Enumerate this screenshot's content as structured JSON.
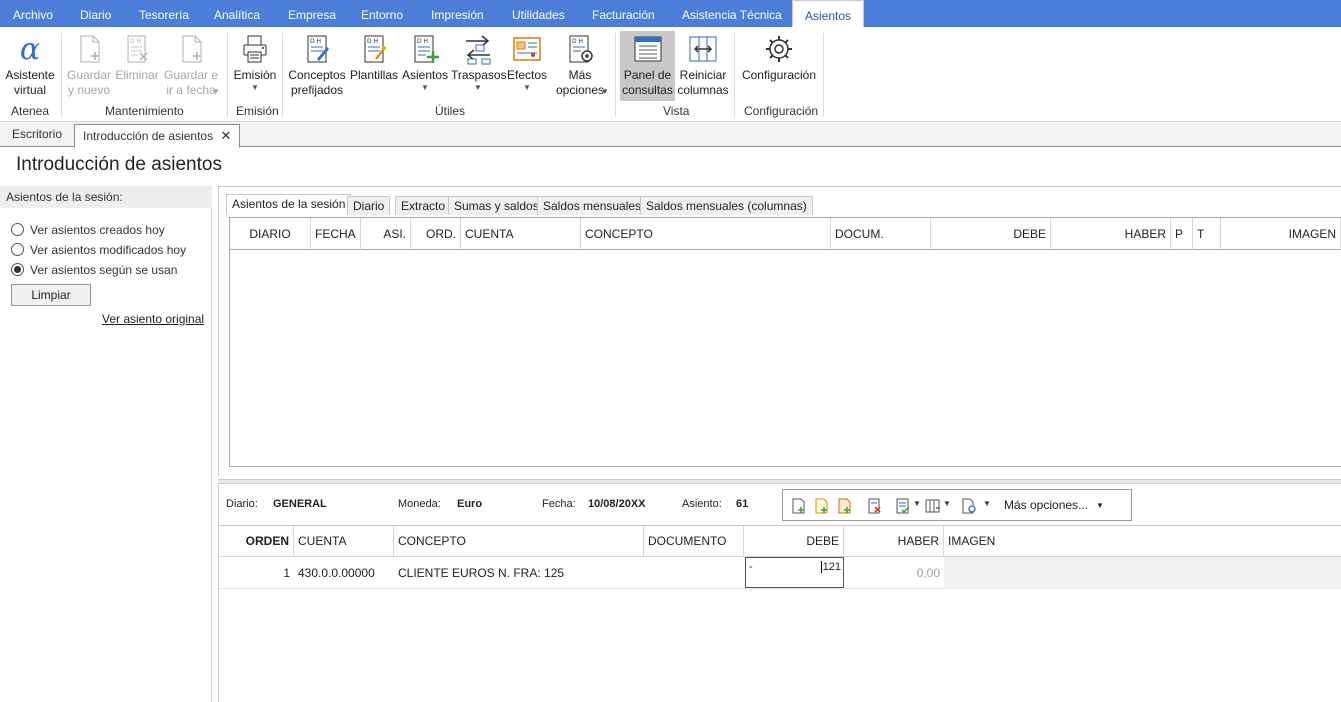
{
  "menu": {
    "items": [
      "Archivo",
      "Diario",
      "Tesorería",
      "Analítica",
      "Empresa",
      "Entorno",
      "Impresión",
      "Utilidades",
      "Facturación",
      "Asistencia Técnica"
    ],
    "active": "Asientos"
  },
  "ribbon": {
    "buttons": {
      "asistente": "Asistente\nvirtual",
      "guardar_nuevo": "Guardar\ny nuevo",
      "eliminar": "Eliminar",
      "guardar_fecha": "Guardar e\nir a fecha",
      "emision": "Emisión",
      "conceptos": "Conceptos\nprefijados",
      "plantillas": "Plantillas",
      "asientos": "Asientos",
      "traspasos": "Traspasos",
      "efectos": "Efectos",
      "mas_opciones": "Más\nopciones",
      "panel": "Panel de\nconsultas",
      "reiniciar": "Reiniciar\ncolumnas",
      "configuracion": "Configuración"
    },
    "groups": {
      "atenea": "Atenea",
      "mantenimiento": "Mantenimiento",
      "emision": "Emisión",
      "utiles": "Útiles",
      "vista": "Vista",
      "configuracion": "Configuración"
    }
  },
  "doc_tabs": {
    "escritorio": "Escritorio",
    "introduccion": "Introducción de asientos"
  },
  "page_title": "Introducción de asientos",
  "left_panel": {
    "title": "Asientos de la sesión:",
    "options": [
      "Ver asientos creados hoy",
      "Ver asientos modificados hoy",
      "Ver asientos según se usan"
    ],
    "selected_index": 2,
    "clear_button": "Limpiar",
    "original_link": "Ver asiento original"
  },
  "sub_tabs": [
    "Asientos de la sesión",
    "Diario",
    "Extracto",
    "Sumas y saldos",
    "Saldos mensuales",
    "Saldos mensuales (columnas)"
  ],
  "grid1": {
    "columns": [
      "DIARIO",
      "FECHA",
      "ASI.",
      "ORD.",
      "CUENTA",
      "CONCEPTO",
      "DOCUM.",
      "DEBE",
      "HABER",
      "P",
      "T",
      "IMAGEN"
    ]
  },
  "entry": {
    "diario_label": "Diario:",
    "diario_value": "GENERAL",
    "moneda_label": "Moneda:",
    "moneda_value": "Euro",
    "fecha_label": "Fecha:",
    "fecha_value": "10/08/20XX",
    "asiento_label": "Asiento:",
    "asiento_value": "61",
    "more_options": "Más opciones..."
  },
  "grid2": {
    "columns": [
      "ORDEN",
      "CUENTA",
      "CONCEPTO",
      "DOCUMENTO",
      "DEBE",
      "HABER",
      "IMAGEN"
    ],
    "row": {
      "orden": "1",
      "cuenta": "430.0.0.00000",
      "concepto": "CLIENTE EUROS N. FRA:  125",
      "documento": "",
      "debe_sign": "-",
      "debe": "121",
      "haber": "0,00"
    }
  },
  "colors": {
    "menubar": "#4a7ed8",
    "active_tab_text": "#2b579a",
    "icon_blue": "#2f6fc4",
    "icon_green": "#3aa03a",
    "icon_red": "#d23a3a"
  }
}
